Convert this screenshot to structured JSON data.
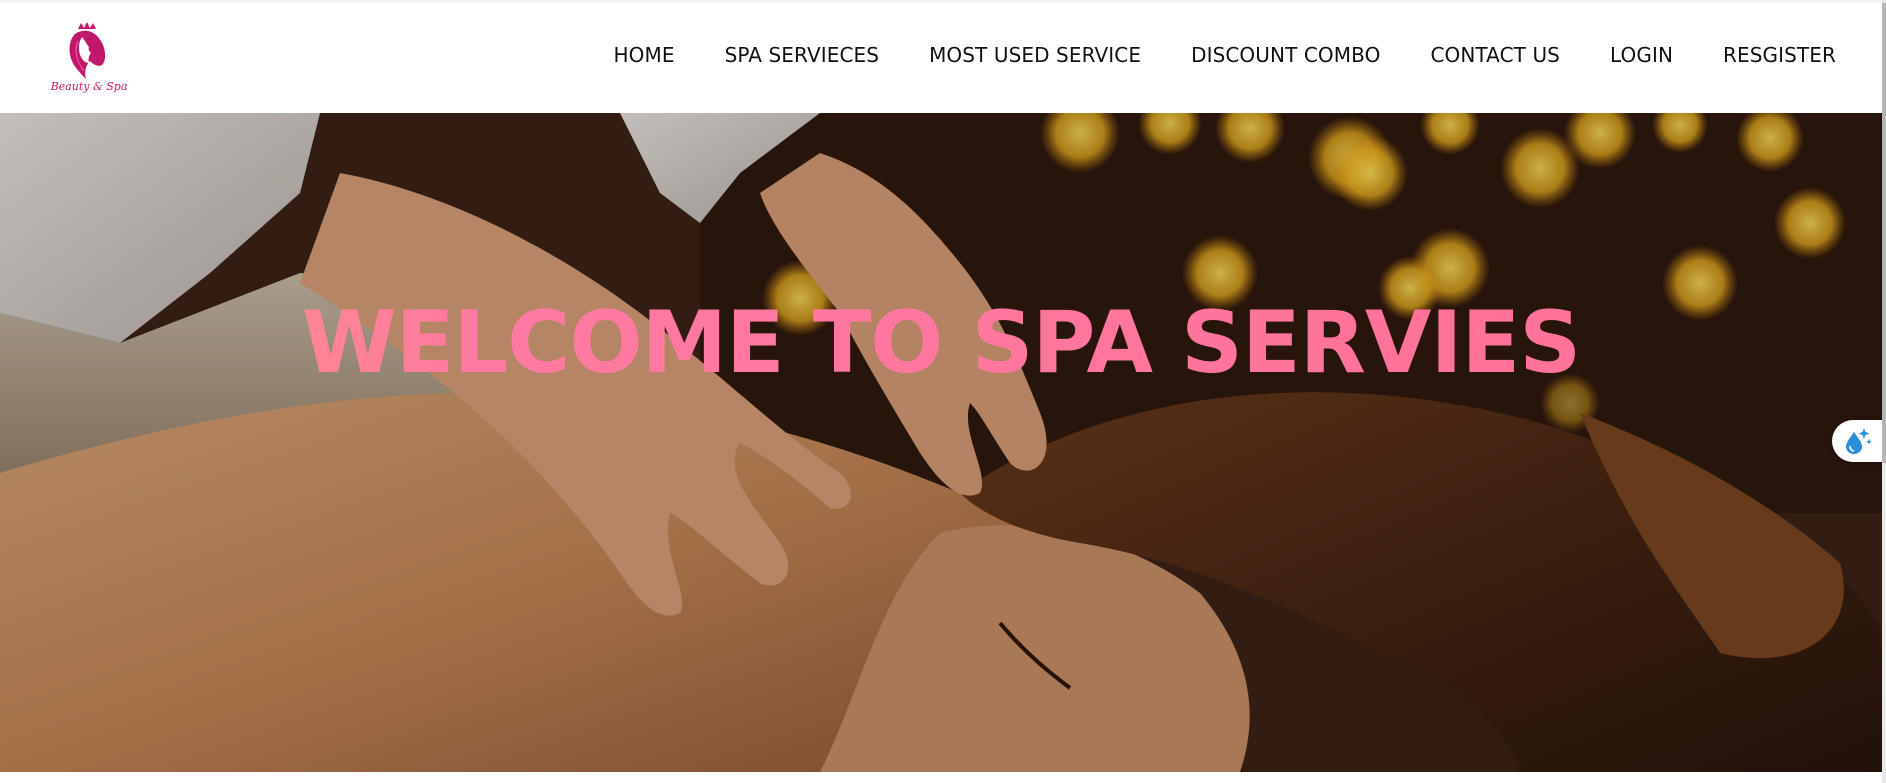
{
  "brand": {
    "logo_text": "Beauty & Spa",
    "logo_icon": "woman-crown-silhouette-icon",
    "brand_color": "#c2186b"
  },
  "nav": {
    "items": [
      {
        "label": "HOME"
      },
      {
        "label": "SPA SERVIECES"
      },
      {
        "label": "MOST USED SERVICE"
      },
      {
        "label": "DISCOUNT COMBO"
      },
      {
        "label": "CONTACT US"
      },
      {
        "label": "LOGIN"
      },
      {
        "label": "RESGISTER"
      }
    ]
  },
  "hero": {
    "title": "WELCOME TO SPA SERVIES",
    "title_color_start": "#ffab7a",
    "title_color_end": "#ff6f96",
    "background_description_icon": "spa-massage-photo"
  },
  "floating_widget": {
    "icon": "water-drop-sparkle-icon",
    "accent_color": "#2b8fd9"
  }
}
